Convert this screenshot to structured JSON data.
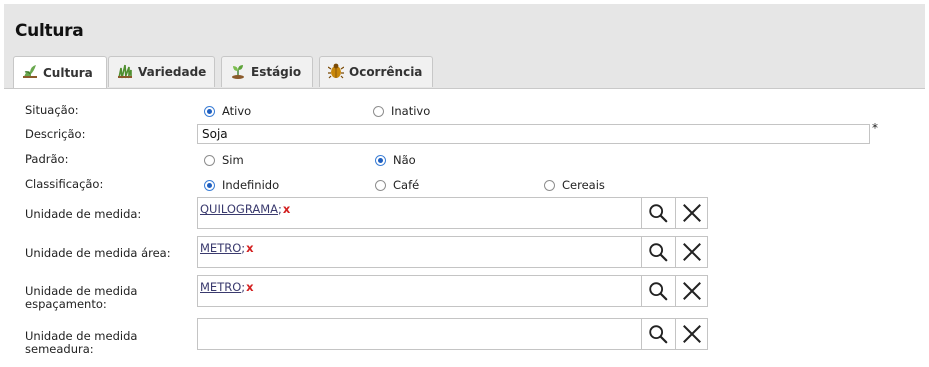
{
  "header": {
    "title": "Cultura"
  },
  "tabs": [
    {
      "label": "Cultura",
      "icon": "plant-icon"
    },
    {
      "label": "Variedade",
      "icon": "grass-icon"
    },
    {
      "label": "Estágio",
      "icon": "seedling-icon"
    },
    {
      "label": "Ocorrência",
      "icon": "bug-icon"
    }
  ],
  "form": {
    "situacao": {
      "label": "Situação:",
      "options": [
        "Ativo",
        "Inativo"
      ],
      "selected": "Ativo"
    },
    "descricao": {
      "label": "Descrição:",
      "value": "Soja",
      "required_mark": "*"
    },
    "padrao": {
      "label": "Padrão:",
      "options": [
        "Sim",
        "Não"
      ],
      "selected": "Não"
    },
    "classificacao": {
      "label": "Classificação:",
      "options": [
        "Indefinido",
        "Café",
        "Cereais"
      ],
      "selected": "Indefinido"
    },
    "unidade_medida": {
      "label": "Unidade de medida:",
      "value": "QUILOGRAMA",
      "separator": ";",
      "remove": "x"
    },
    "unidade_medida_area": {
      "label": "Unidade de medida área:",
      "value": "METRO",
      "separator": ";",
      "remove": "x"
    },
    "unidade_medida_espacamento": {
      "label_line1": "Unidade de medida",
      "label_line2": "espaçamento:",
      "value": "METRO",
      "separator": ";",
      "remove": "x"
    },
    "unidade_medida_semeadura": {
      "label_line1": "Unidade de medida",
      "label_line2": "semeadura:",
      "value": ""
    }
  },
  "colors": {
    "accent": "#1f5fbf",
    "remove": "#d32020",
    "header_bg": "#e6e6e6"
  }
}
